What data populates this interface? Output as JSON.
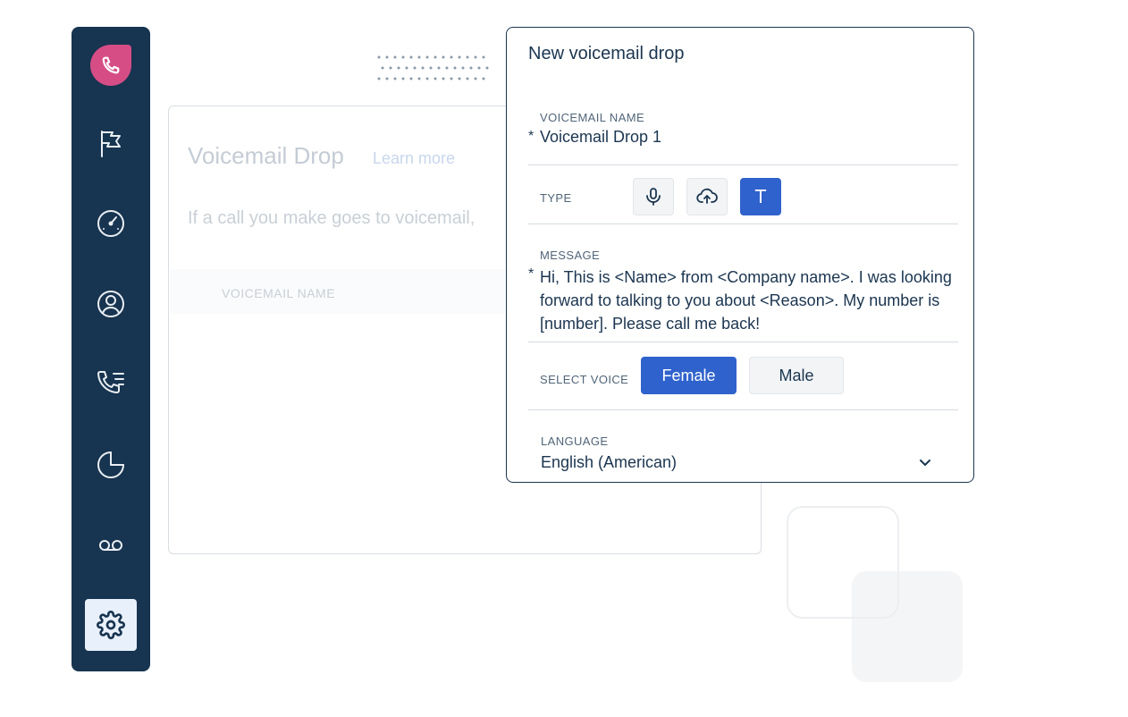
{
  "background_panel": {
    "title": "Voicemail Drop",
    "learn_more": "Learn more",
    "description": "If a call you make goes to voicemail,",
    "table_column": "VOICEMAIL NAME"
  },
  "sidebar": {
    "logo_icon": "phone-icon",
    "items": [
      {
        "icon": "flag-icon"
      },
      {
        "icon": "gauge-icon"
      },
      {
        "icon": "user-circle-icon"
      },
      {
        "icon": "call-list-icon"
      },
      {
        "icon": "pie-chart-icon"
      },
      {
        "icon": "voicemail-icon"
      },
      {
        "icon": "gear-icon",
        "active": true
      }
    ]
  },
  "modal": {
    "title": "New voicemail drop",
    "voicemail_name_label": "VOICEMAIL NAME",
    "voicemail_name_value": "Voicemail Drop 1",
    "required_marker": "*",
    "type_label": "TYPE",
    "type_options": [
      {
        "icon": "microphone-icon"
      },
      {
        "icon": "cloud-upload-icon"
      },
      {
        "icon": "text-icon",
        "glyph": "T",
        "selected": true
      }
    ],
    "message_label": "MESSAGE",
    "message_value": "Hi, This is <Name> from <Company name>. I was looking forward to talking to you about <Reason>. My number is [number]. Please call me back!",
    "select_voice_label": "SELECT VOICE",
    "voice_options": {
      "female": "Female",
      "male": "Male",
      "selected": "Female"
    },
    "language_label": "LANGUAGE",
    "language_value": "English (American)"
  },
  "colors": {
    "sidebar": "#173450",
    "accent": "#2f62cc",
    "logo": "#d64d86",
    "text": "#1b3550"
  }
}
